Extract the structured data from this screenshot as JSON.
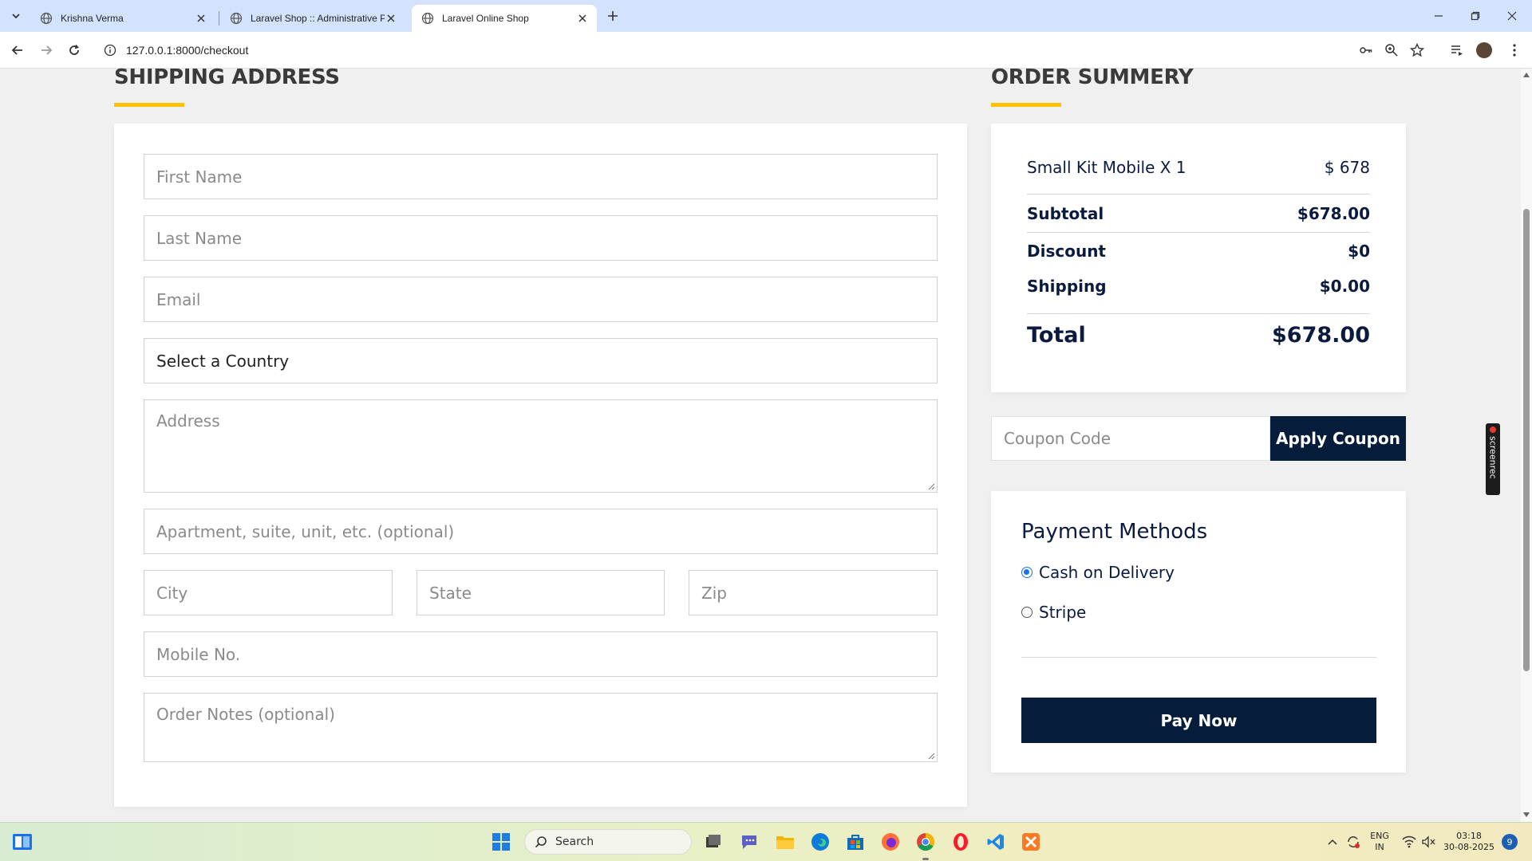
{
  "browser": {
    "tabs": [
      {
        "title": "Krishna Verma",
        "active": false
      },
      {
        "title": "Laravel Shop :: Administrative P",
        "active": false
      },
      {
        "title": "Laravel Online Shop",
        "active": true
      }
    ],
    "url": "127.0.0.1:8000/checkout"
  },
  "shipping": {
    "title": "SHIPPING ADDRESS",
    "fields": {
      "first_name": "First Name",
      "last_name": "Last Name",
      "email": "Email",
      "country": "Select a Country",
      "address": "Address",
      "apartment": "Apartment, suite, unit, etc. (optional)",
      "city": "City",
      "state": "State",
      "zip": "Zip",
      "mobile": "Mobile No.",
      "notes": "Order Notes (optional)"
    }
  },
  "summary": {
    "title": "ORDER SUMMERY",
    "item": {
      "name": "Small Kit Mobile X 1",
      "price": "$ 678"
    },
    "subtotal_label": "Subtotal",
    "subtotal_value": "$678.00",
    "discount_label": "Discount",
    "discount_value": "$0",
    "shipping_label": "Shipping",
    "shipping_value": "$0.00",
    "total_label": "Total",
    "total_value": "$678.00"
  },
  "coupon": {
    "placeholder": "Coupon Code",
    "button": "Apply Coupon"
  },
  "payment": {
    "title": "Payment Methods",
    "options": [
      {
        "label": "Cash on Delivery",
        "checked": true
      },
      {
        "label": "Stripe",
        "checked": false
      }
    ],
    "pay_button": "Pay Now"
  },
  "screenrec_label": "screenrec",
  "taskbar": {
    "search_label": "Search",
    "lang_top": "ENG",
    "lang_bottom": "IN",
    "time": "03:18",
    "date": "30-08-2025",
    "notification_count": "9"
  },
  "colors": {
    "accent_yellow": "#ffc107",
    "navy": "#051c3b",
    "tabbar": "#d3e3fd"
  }
}
